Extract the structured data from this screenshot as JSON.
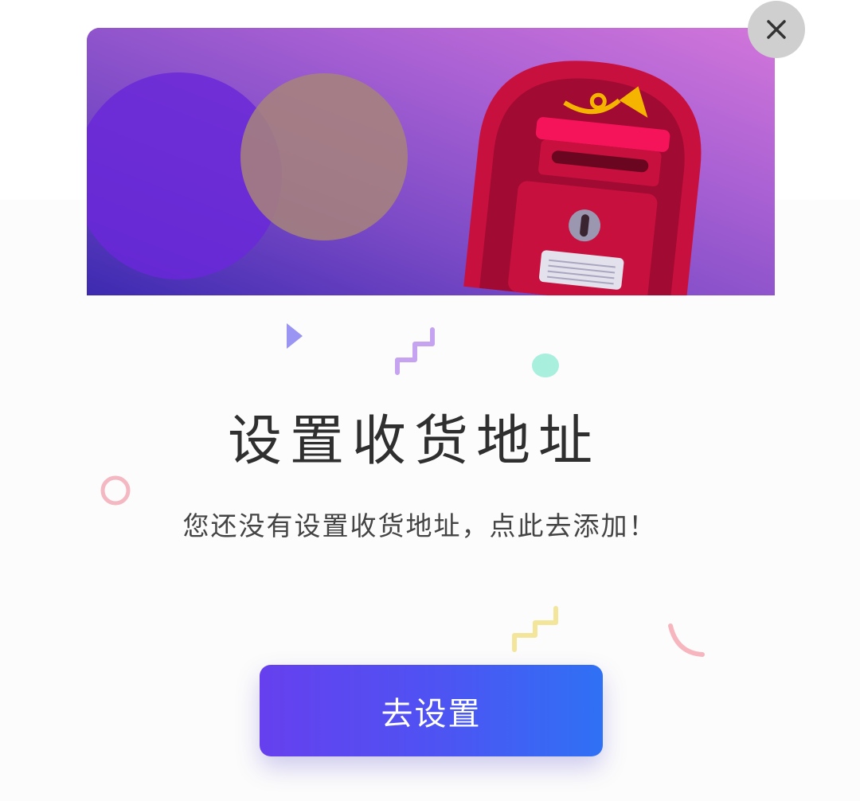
{
  "dialog": {
    "title": "设置收货地址",
    "message": "您还没有设置收货地址，点此去添加！",
    "primary_button_label": "去设置",
    "close_icon": "close-icon"
  },
  "illustration": {
    "subject": "mailbox-icon"
  },
  "colors": {
    "button_gradient_start": "#6640ee",
    "button_gradient_end": "#2f71f5",
    "banner_gradient_start": "#4f34b8",
    "banner_gradient_end": "#cd72d8",
    "mailbox_red": "#c8103e"
  }
}
